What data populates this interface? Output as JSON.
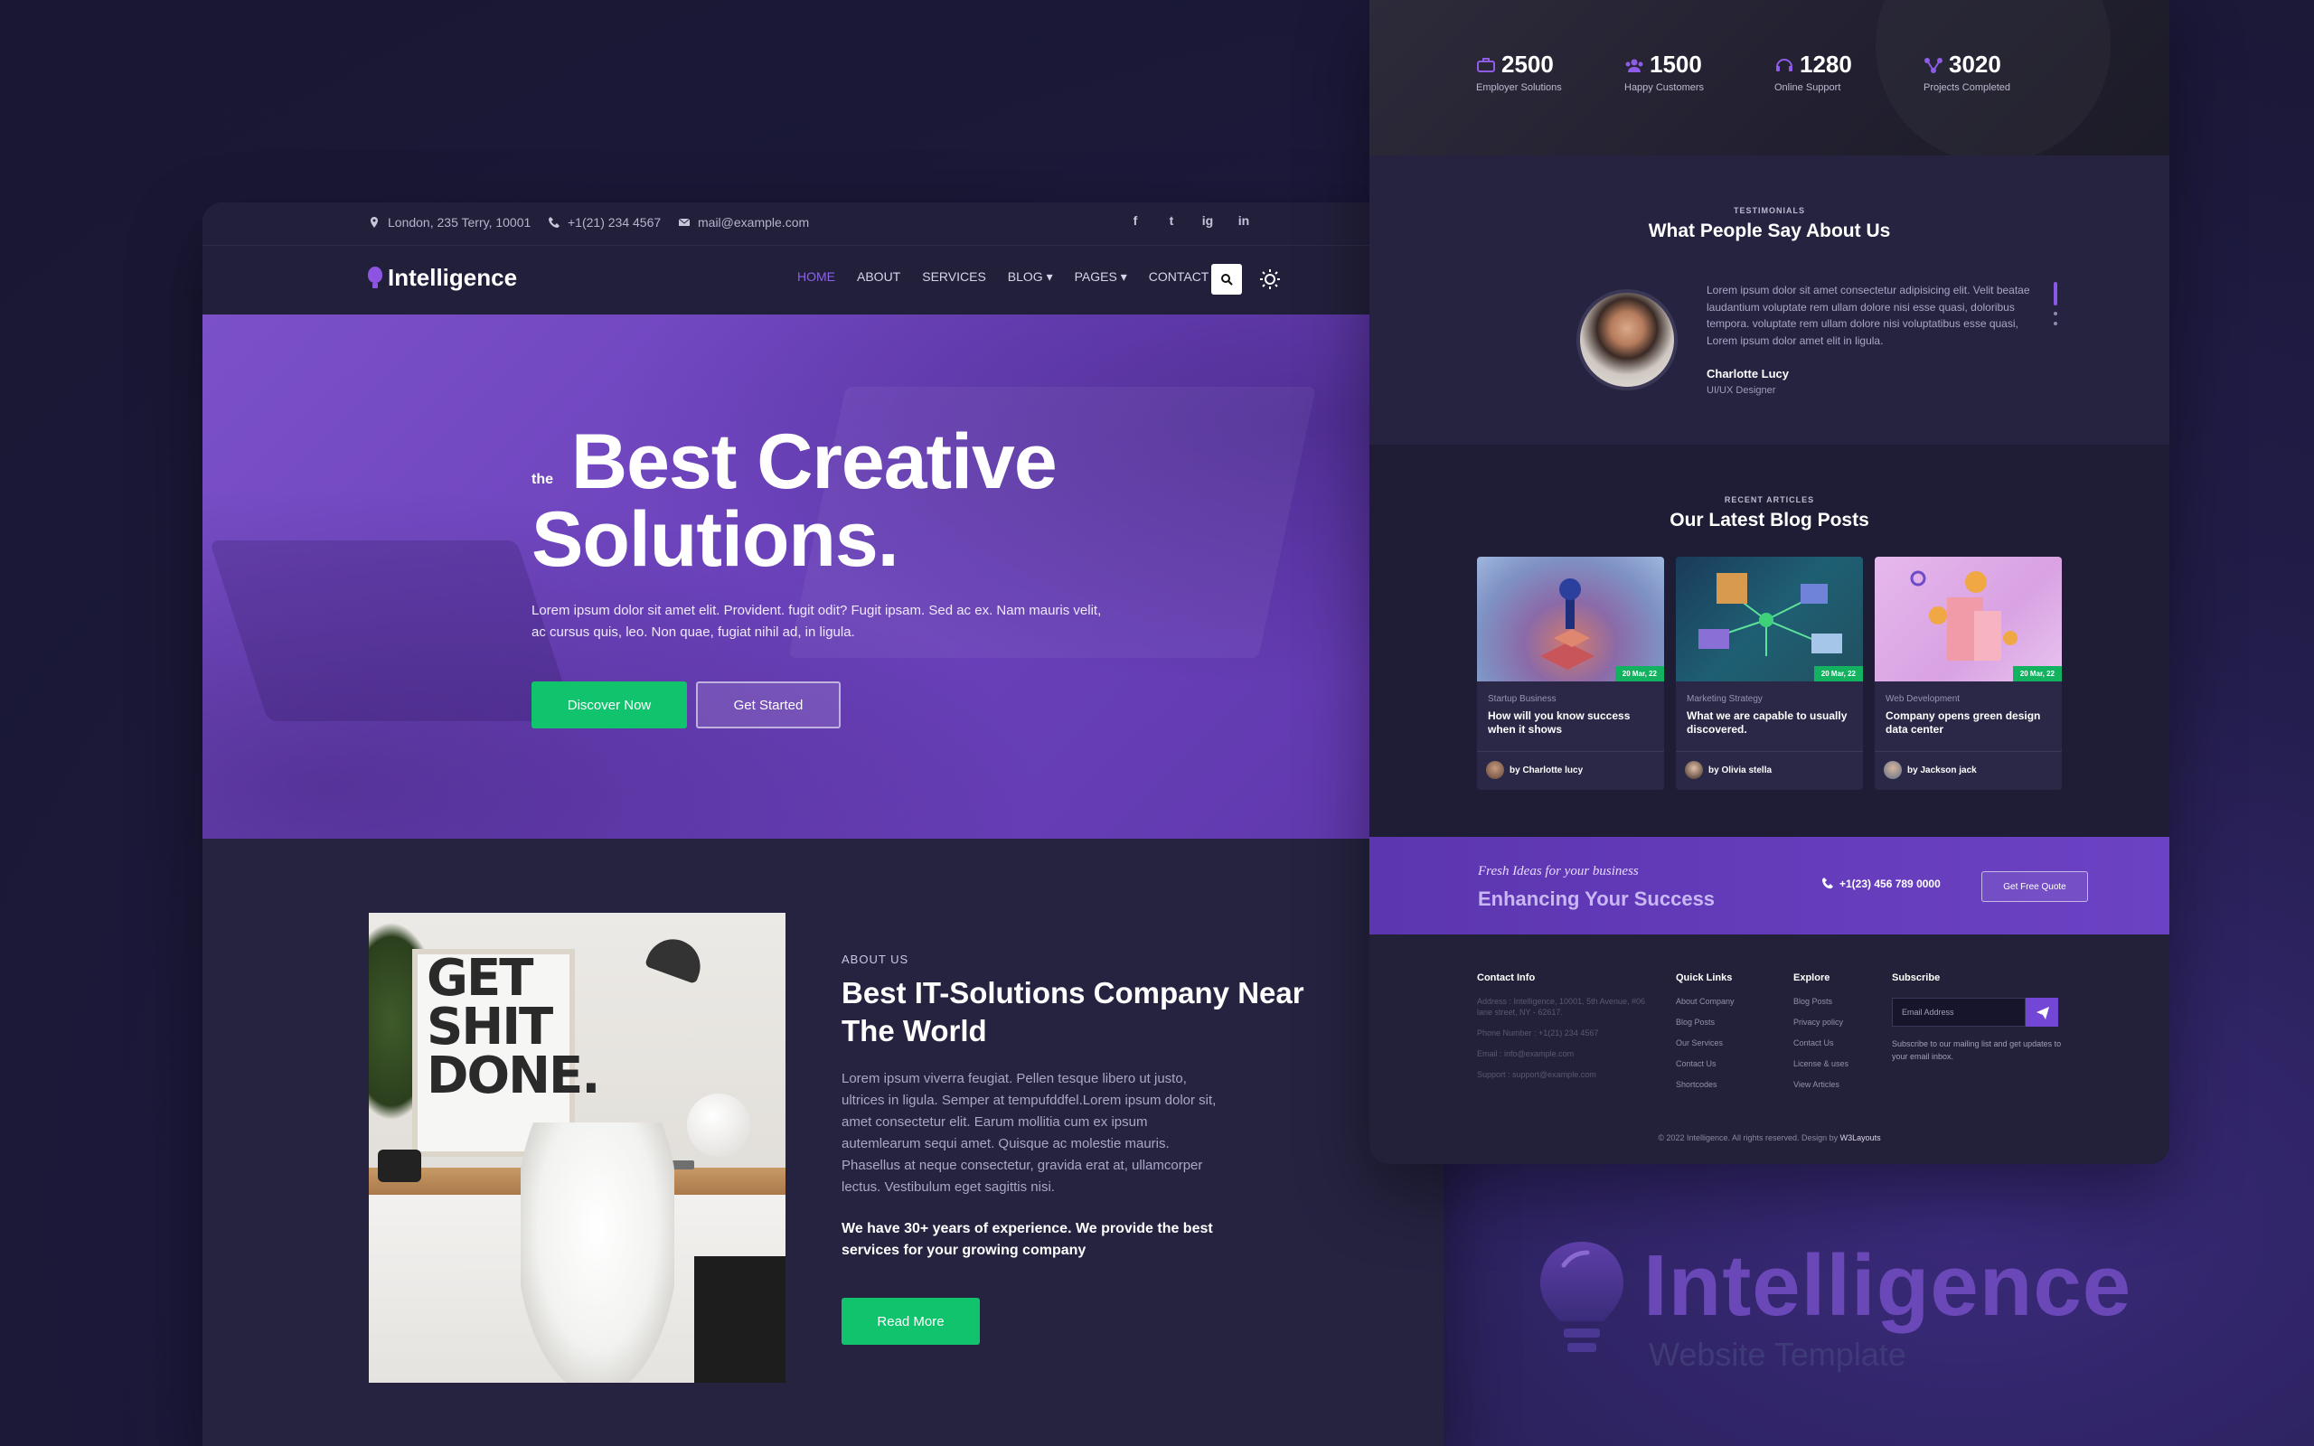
{
  "left": {
    "topbar": {
      "address": "London, 235 Terry, 10001",
      "phone": "+1(21) 234 4567",
      "email": "mail@example.com",
      "social": [
        "f",
        "t",
        "ig",
        "in"
      ]
    },
    "logo": "Intelligence",
    "nav": [
      "HOME",
      "ABOUT",
      "SERVICES",
      "BLOG",
      "PAGES",
      "CONTACT"
    ],
    "hero": {
      "the": "the",
      "title_line1": "Best Creative",
      "title_line2": "Solutions.",
      "text": "Lorem ipsum dolor sit amet elit. Provident. fugit odit? Fugit ipsam. Sed ac ex. Nam mauris velit, ac cursus quis, leo. Non quae, fugiat nihil ad, in ligula.",
      "primary_button": "Discover Now",
      "secondary_button": "Get Started"
    },
    "about": {
      "poster_lines": [
        "GET",
        "SHIT",
        "DONE."
      ],
      "label": "ABOUT US",
      "title": "Best IT-Solutions Company Near The World",
      "text": "Lorem ipsum viverra feugiat. Pellen tesque libero ut justo, ultrices in ligula. Semper at tempufddfel.Lorem ipsum dolor sit, amet consectetur elit. Earum mollitia cum ex ipsum autemlearum sequi amet. Quisque ac molestie mauris. Phasellus at neque consectetur, gravida erat at, ullamcorper lectus. Vestibulum eget sagittis nisi.",
      "bold_text": "We have 30+ years of experience. We provide the best services for your growing company",
      "button": "Read More"
    }
  },
  "right": {
    "stats": [
      {
        "num": "2500",
        "label": "Employer Solutions",
        "icon": "briefcase-icon"
      },
      {
        "num": "1500",
        "label": "Happy Customers",
        "icon": "users-icon"
      },
      {
        "num": "1280",
        "label": "Online Support",
        "icon": "headset-icon"
      },
      {
        "num": "3020",
        "label": "Projects Completed",
        "icon": "network-icon"
      }
    ],
    "testimonials": {
      "label": "TESTIMONIALS",
      "title": "What People Say About Us",
      "quote": "Lorem ipsum dolor sit amet consectetur adipisicing elit. Velit beatae laudantium voluptate rem ullam dolore nisi esse quasi, doloribus tempora. voluptate rem ullam dolore nisi voluptatibus esse quasi, Lorem ipsum dolor amet elit in ligula.",
      "name": "Charlotte Lucy",
      "role": "UI/UX Designer"
    },
    "blog": {
      "label": "RECENT ARTICLES",
      "title": "Our Latest Blog Posts",
      "posts": [
        {
          "date": "20 Mar, 22",
          "category": "Startup Business",
          "title": "How will you know success when it shows",
          "author": "by Charlotte lucy"
        },
        {
          "date": "20 Mar, 22",
          "category": "Marketing Strategy",
          "title": "What we are capable to usually discovered.",
          "author": "by Olivia stella"
        },
        {
          "date": "20 Mar, 22",
          "category": "Web Development",
          "title": "Company opens green design data center",
          "author": "by Jackson jack"
        }
      ]
    },
    "cta": {
      "tagline": "Fresh Ideas for your business",
      "headline": "Enhancing Your Success",
      "phone": "+1(23) 456 789 0000",
      "button": "Get Free Quote"
    },
    "footer": {
      "contact_head": "Contact Info",
      "contact": [
        "Address : Intelligence, 10001, 5th Avenue, #06 lane street, NY - 62617.",
        "Phone Number : +1(21) 234 4567",
        "Email : info@example.com",
        "Support : support@example.com"
      ],
      "quick_head": "Quick Links",
      "quick": [
        "About Company",
        "Blog Posts",
        "Our Services",
        "Contact Us",
        "Shortcodes"
      ],
      "explore_head": "Explore",
      "explore": [
        "Blog Posts",
        "Privacy policy",
        "Contact Us",
        "License & uses",
        "View Articles"
      ],
      "subscribe_head": "Subscribe",
      "subscribe_placeholder": "Email Address",
      "subscribe_text": "Subscribe to our mailing list and get updates to your email inbox.",
      "copyright": "© 2022 Intelligence. All rights reserved. Design by",
      "credit": "W3Layouts"
    }
  },
  "brand": {
    "name": "Intelligence",
    "subtitle": "Website Template"
  },
  "colors": {
    "accent": "#7b50c8",
    "green": "#10c36c",
    "background": "#1b1838"
  }
}
